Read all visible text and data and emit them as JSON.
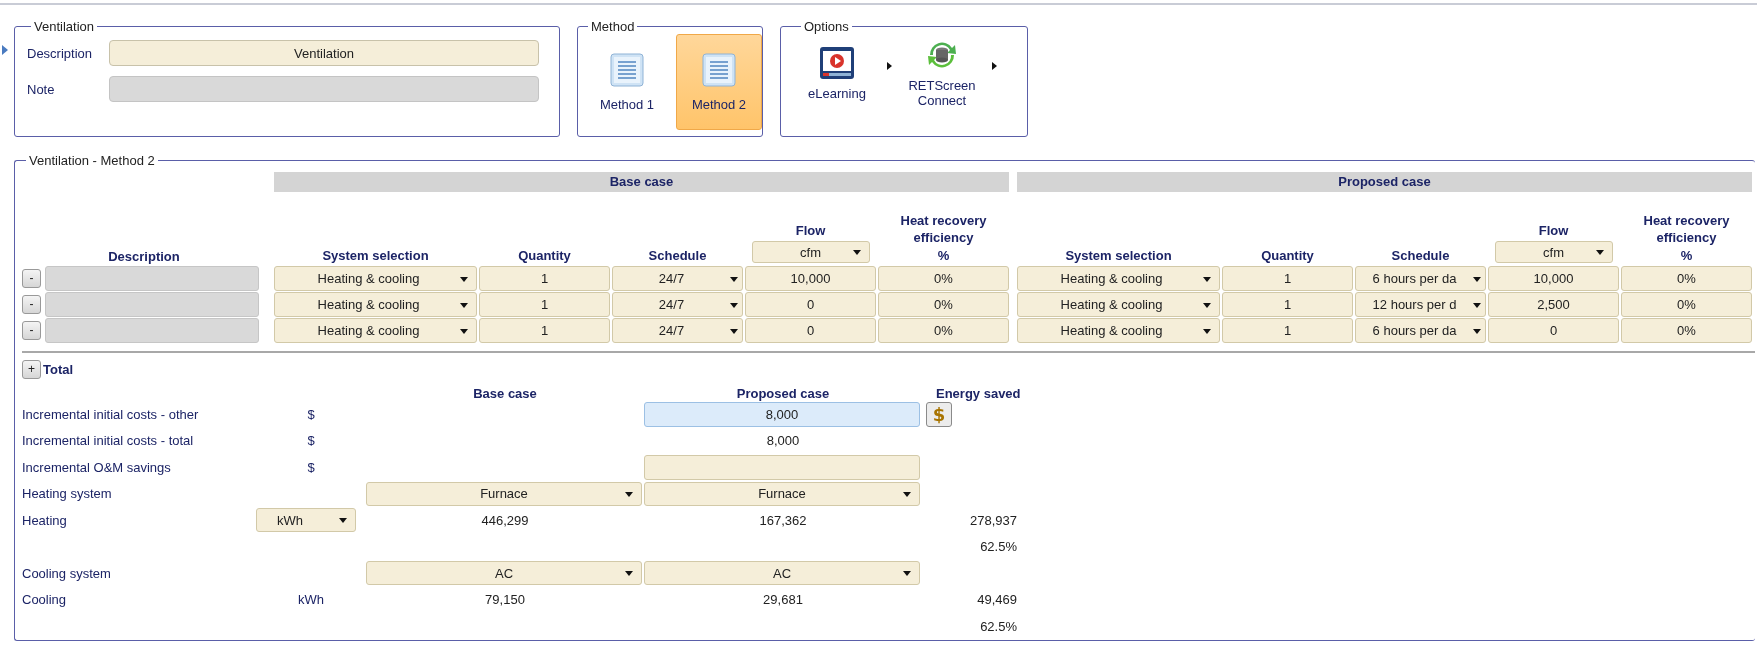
{
  "ventilation": {
    "title": "Ventilation",
    "description_label": "Description",
    "description": "Ventilation",
    "note_label": "Note"
  },
  "method": {
    "title": "Method",
    "options": [
      {
        "label": "Method 1",
        "selected": false
      },
      {
        "label": "Method 2",
        "selected": true
      }
    ]
  },
  "options": {
    "title": "Options",
    "items": [
      {
        "label": "eLearning",
        "kind": "video"
      },
      {
        "label": "RETScreen Connect",
        "kind": "database"
      }
    ]
  },
  "table": {
    "title": "Ventilation - Method 2",
    "description_header": "Description",
    "groups": [
      {
        "title": "Base case",
        "system_header": "System selection",
        "quantity_header": "Quantity",
        "schedule_header": "Schedule",
        "flow_header": "Flow",
        "flow_unit": "cfm",
        "hre_header": "Heat recovery efficiency",
        "hre_unit": "%"
      },
      {
        "title": "Proposed case",
        "system_header": "System selection",
        "quantity_header": "Quantity",
        "schedule_header": "Schedule",
        "flow_header": "Flow",
        "flow_unit": "cfm",
        "hre_header": "Heat recovery efficiency",
        "hre_unit": "%"
      }
    ],
    "rows": [
      {
        "remove": "-",
        "cases": [
          {
            "system": "Heating & cooling",
            "quantity": "1",
            "schedule": "24/7",
            "flow": "10,000",
            "hre": "0%"
          },
          {
            "system": "Heating & cooling",
            "quantity": "1",
            "schedule": "6 hours per da",
            "flow": "10,000",
            "hre": "0%"
          }
        ]
      },
      {
        "remove": "-",
        "cases": [
          {
            "system": "Heating & cooling",
            "quantity": "1",
            "schedule": "24/7",
            "flow": "0",
            "hre": "0%"
          },
          {
            "system": "Heating & cooling",
            "quantity": "1",
            "schedule": "12 hours per d",
            "flow": "2,500",
            "hre": "0%"
          }
        ]
      },
      {
        "remove": "-",
        "cases": [
          {
            "system": "Heating & cooling",
            "quantity": "1",
            "schedule": "24/7",
            "flow": "0",
            "hre": "0%"
          },
          {
            "system": "Heating & cooling",
            "quantity": "1",
            "schedule": "6 hours per da",
            "flow": "0",
            "hre": "0%"
          }
        ]
      }
    ]
  },
  "summary": {
    "toggle": "+",
    "title": "Total",
    "headers": [
      "Base case",
      "Proposed case",
      "Energy saved"
    ],
    "rows": [
      {
        "kind": "input",
        "label": "Incremental initial costs - other",
        "unit": "$",
        "proposed": "8,000",
        "focused": true,
        "button": "$"
      },
      {
        "kind": "text",
        "label": "Incremental initial costs - total",
        "unit": "$",
        "proposed": "8,000"
      },
      {
        "kind": "input",
        "label": "Incremental O&M savings",
        "unit": "$",
        "focused": false
      },
      {
        "kind": "select",
        "label": "Heating system",
        "base": "Furnace",
        "proposed": "Furnace"
      },
      {
        "kind": "energy",
        "label": "Heating",
        "unit": "kWh",
        "unit_select": true,
        "base": "446,299",
        "proposed": "167,362",
        "saved": "278,937"
      },
      {
        "kind": "percent",
        "saved": "62.5%"
      },
      {
        "kind": "select",
        "label": "Cooling system",
        "base": "AC",
        "proposed": "AC"
      },
      {
        "kind": "energy",
        "label": "Cooling",
        "unit": "kWh",
        "unit_select": false,
        "base": "79,150",
        "proposed": "29,681",
        "saved": "49,469"
      },
      {
        "kind": "percent",
        "saved": "62.5%"
      }
    ]
  }
}
